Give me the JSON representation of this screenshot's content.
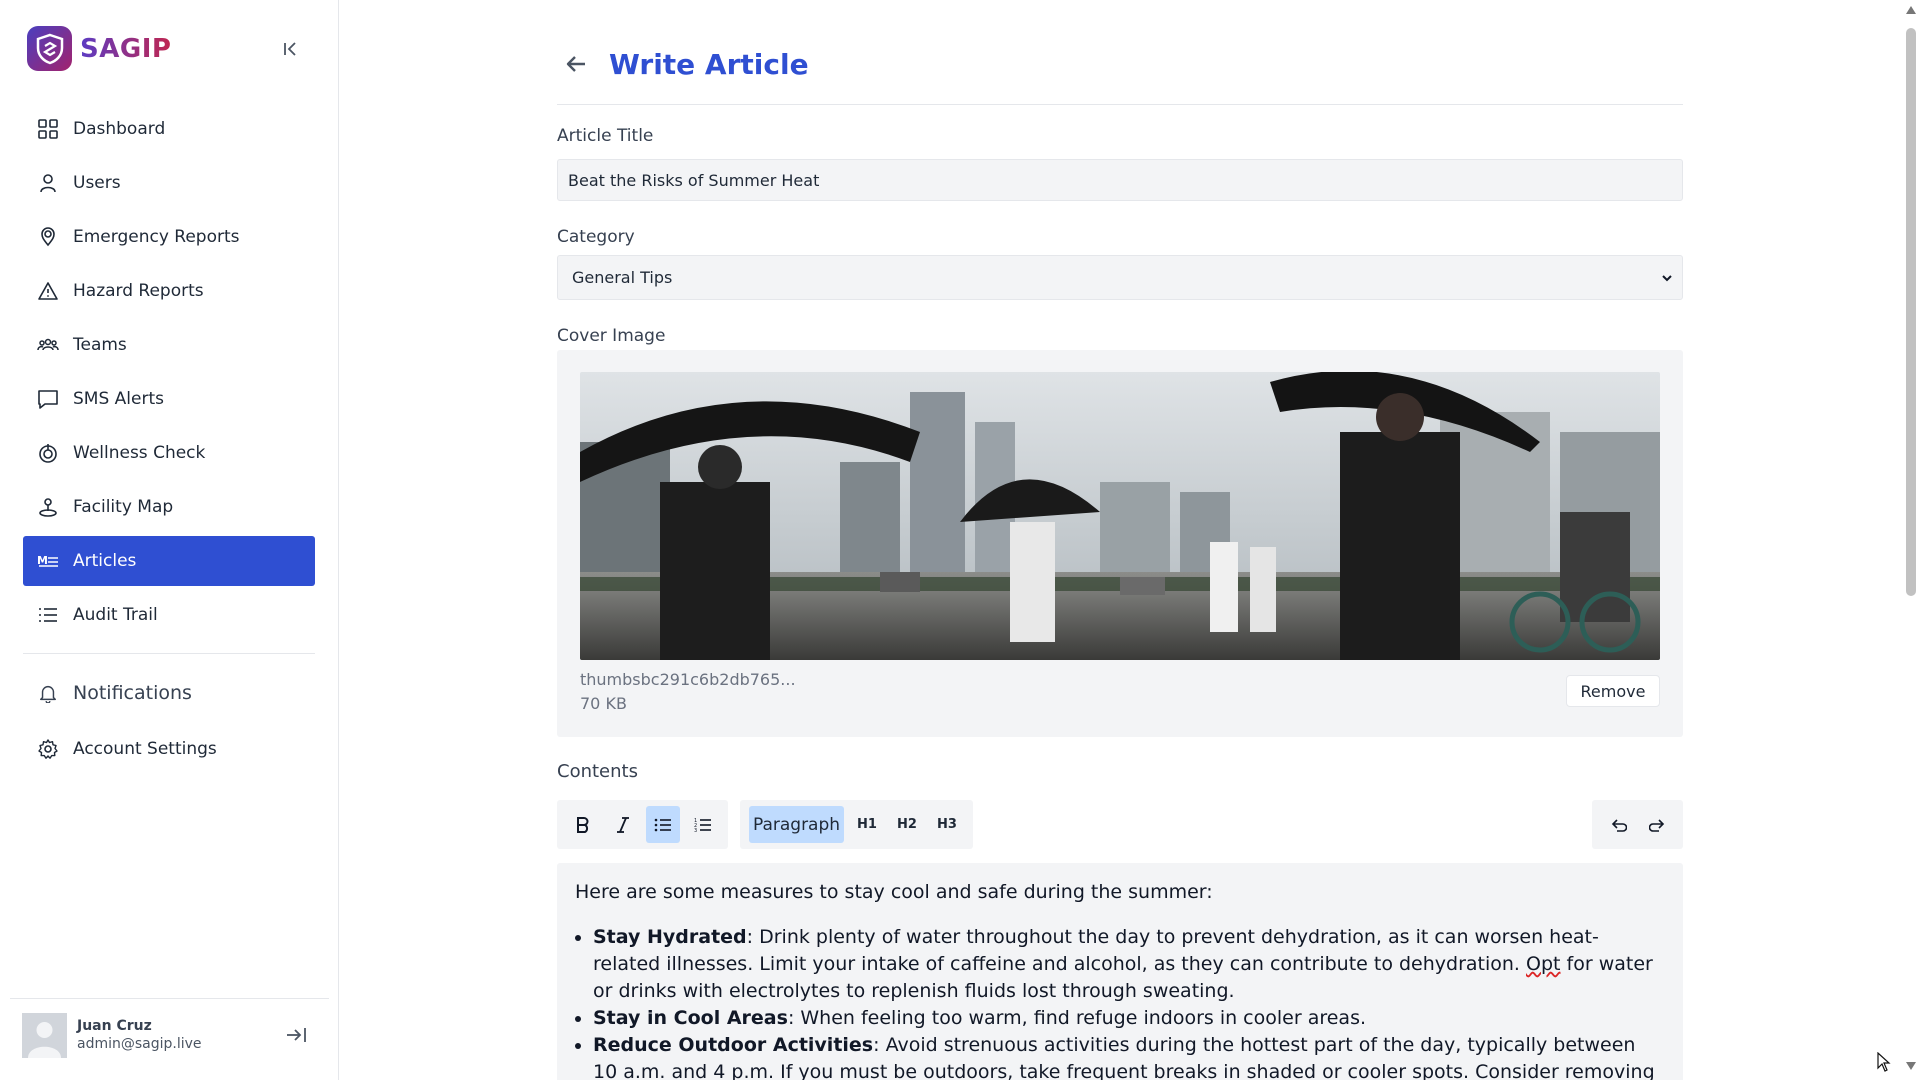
{
  "brand": {
    "name": "SAGIP"
  },
  "sidebar": {
    "items": [
      {
        "label": "Dashboard",
        "icon": "dashboard-icon"
      },
      {
        "label": "Users",
        "icon": "user-icon"
      },
      {
        "label": "Emergency Reports",
        "icon": "location-pin-icon"
      },
      {
        "label": "Hazard Reports",
        "icon": "warning-icon"
      },
      {
        "label": "Teams",
        "icon": "team-icon"
      },
      {
        "label": "SMS Alerts",
        "icon": "message-icon"
      },
      {
        "label": "Wellness Check",
        "icon": "wellness-icon"
      },
      {
        "label": "Facility Map",
        "icon": "map-pin-icon"
      },
      {
        "label": "Articles",
        "icon": "markdown-icon",
        "active": true
      },
      {
        "label": "Audit Trail",
        "icon": "list-icon"
      }
    ],
    "secondary": [
      {
        "label": "Notifications",
        "icon": "bell-icon"
      },
      {
        "label": "Account Settings",
        "icon": "gear-icon"
      }
    ],
    "user": {
      "name": "Juan Cruz",
      "email": "admin@sagip.live"
    }
  },
  "header": {
    "title": "Write Article"
  },
  "form": {
    "title_label": "Article Title",
    "title_value": "Beat the Risks of Summer Heat",
    "category_label": "Category",
    "category_value": "General Tips",
    "cover_label": "Cover Image",
    "file_name": "thumbsbc291c6b2db765...",
    "file_size": "70 KB",
    "remove_label": "Remove",
    "contents_label": "Contents"
  },
  "toolbar": {
    "bold": "B",
    "italic": "I",
    "paragraph": "Paragraph",
    "h1": "H1",
    "h2": "H2",
    "h3": "H3"
  },
  "editor": {
    "intro": "Here are some measures to stay cool and safe during the summer:",
    "items": [
      {
        "title": "Stay Hydrated",
        "text_a": ": Drink plenty of water throughout the day to prevent dehydration, as it can worsen heat-related illnesses. Limit your intake of caffeine and alcohol, as they can contribute to dehydration. ",
        "misspelled": "Opt",
        "text_b": " for water or drinks with electrolytes to replenish fluids lost through sweating."
      },
      {
        "title": "Stay in Cool Areas",
        "text_a": ": When feeling too warm, find refuge indoors in cooler areas."
      },
      {
        "title": "Reduce Outdoor Activities",
        "text_a": ": Avoid strenuous activities during the hottest part of the day, typically between 10 a.m. and 4 p.m. If you must be outdoors, take frequent breaks in shaded or cooler spots. Consider removing heavy"
      }
    ]
  },
  "colors": {
    "accent": "#2f4fd2",
    "brand_start": "#4a3fbf",
    "brand_end": "#c02650"
  }
}
